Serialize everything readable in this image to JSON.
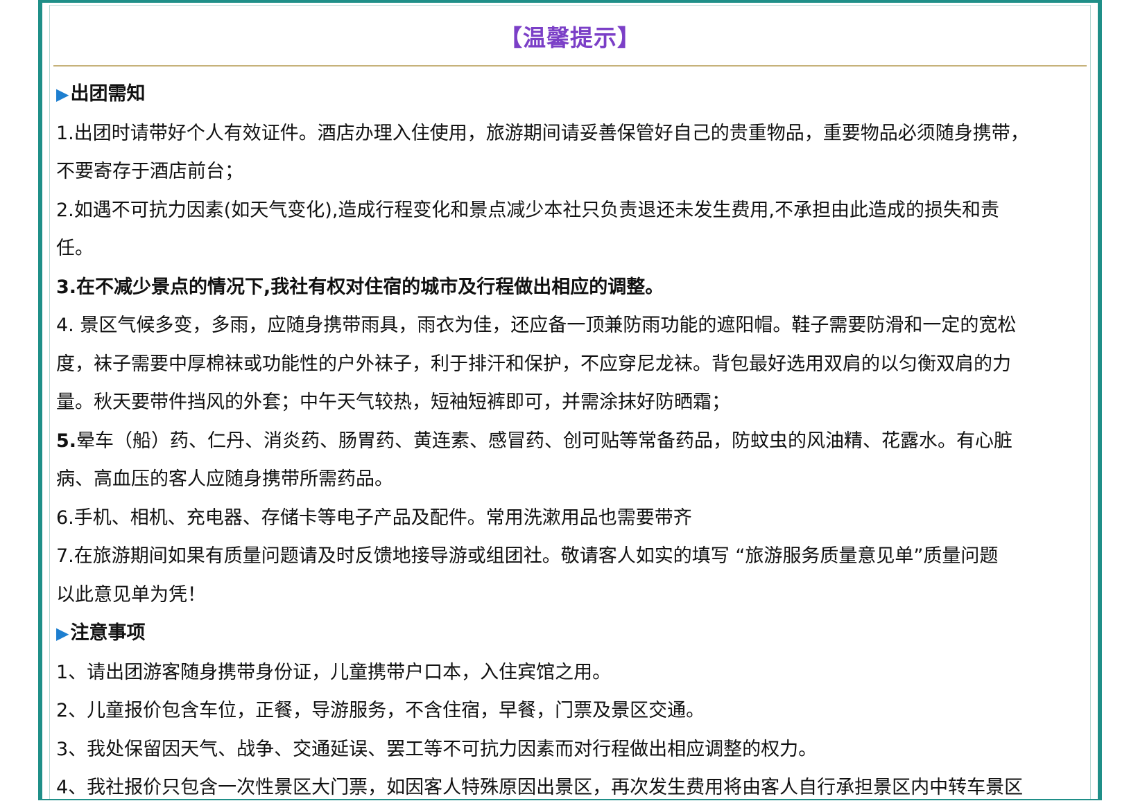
{
  "title": "【温馨提示】",
  "section1": {
    "heading": "出团需知",
    "lines": [
      {
        "text": "1.出团时请带好个人有效证件。酒店办理入住使用，旅游期间请妥善保管好自己的贵重物品，重要物品必须随身携带，",
        "bold": false
      },
      {
        "text": "不要寄存于酒店前台；",
        "bold": false
      },
      {
        "text": "2.如遇不可抗力因素(如天气变化),造成行程变化和景点减少本社只负责退还未发生费用,不承担由此造成的损失和责",
        "bold": false
      },
      {
        "text": "任。",
        "bold": false
      },
      {
        "text": "3.在不减少景点的情况下,我社有权对住宿的城市及行程做出相应的调整。",
        "bold": true
      },
      {
        "text": "4. 景区气候多变，多雨，应随身携带雨具，雨衣为佳，还应备一顶兼防雨功能的遮阳帽。鞋子需要防滑和一定的宽松",
        "bold": false
      },
      {
        "text": "度，袜子需要中厚棉袜或功能性的户外袜子，利于排汗和保护，不应穿尼龙袜。背包最好选用双肩的以匀衡双肩的力",
        "bold": false
      },
      {
        "text": "量。秋天要带件挡风的外套；中午天气较热，短袖短裤即可，并需涂抹好防晒霜；",
        "bold": false
      }
    ],
    "item5_number": "5.",
    "item5_rest": "晕车（船）药、仁丹、消炎药、肠胃药、黄连素、感冒药、创可贴等常备药品，防蚊虫的风油精、花露水。有心脏",
    "lines_after": [
      {
        "text": "病、高血压的客人应随身携带所需药品。",
        "bold": false
      },
      {
        "text": "6.手机、相机、充电器、存储卡等电子产品及配件。常用洗漱用品也需要带齐",
        "bold": false
      },
      {
        "text": "7.在旅游期间如果有质量问题请及时反馈地接导游或组团社。敬请客人如实的填写 “旅游服务质量意见单”质量问题",
        "bold": false
      },
      {
        "text": "以此意见单为凭！",
        "bold": false
      }
    ]
  },
  "section2": {
    "heading": "注意事项",
    "lines": [
      "1、请出团游客随身携带身份证，儿童携带户口本，入住宾馆之用。",
      "2、儿童报价包含车位，正餐，导游服务，不含住宿，早餐，门票及景区交通。",
      "3、我处保留因天气、战争、交通延误、罢工等不可抗力因素而对行程做出相应调整的权力。",
      "4、我社报价只包含一次性景区大门票，如因客人特殊原因出景区，再次发生费用将由客人自行承担景区内中转车景区"
    ]
  },
  "colors": {
    "frame": "#1f8f88",
    "title": "#7b3fc7",
    "bullet": "#1e7fd0",
    "rule": "#c6b27a"
  },
  "icons": {
    "bullet": "triangle-right-icon"
  }
}
